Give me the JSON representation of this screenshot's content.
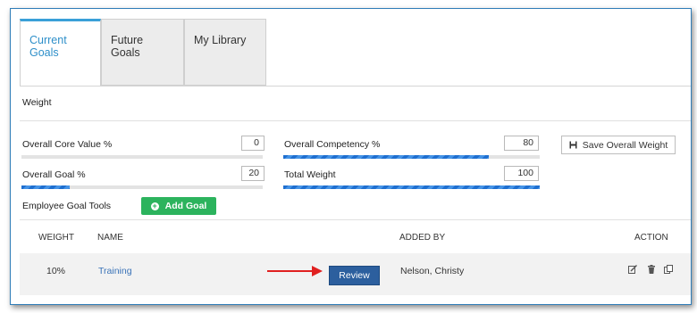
{
  "tabs": [
    {
      "label": "Current Goals",
      "active": true
    },
    {
      "label": "Future Goals",
      "active": false
    },
    {
      "label": "My Library",
      "active": false
    }
  ],
  "section": {
    "title": "Weight"
  },
  "weights": {
    "core_value": {
      "label": "Overall Core Value %",
      "value": "0",
      "progress": 0
    },
    "competency": {
      "label": "Overall Competency %",
      "value": "80",
      "progress": 0.8
    },
    "goal": {
      "label": "Overall Goal %",
      "value": "20",
      "progress": 0.2
    },
    "total": {
      "label": "Total Weight",
      "value": "100",
      "progress": 1.0
    }
  },
  "save_button": {
    "label": "Save Overall Weight",
    "icon": "save-icon"
  },
  "tools": {
    "label": "Employee Goal Tools",
    "add_button": "Add Goal",
    "add_icon": "plus-circle-icon"
  },
  "table": {
    "headers": {
      "weight": "WEIGHT",
      "name": "NAME",
      "added_by": "ADDED BY",
      "action": "ACTION"
    },
    "rows": [
      {
        "weight": "10%",
        "name": "Training",
        "review": "Review",
        "added_by": "Nelson, Christy",
        "actions": [
          "edit-icon",
          "trash-icon",
          "copy-icon"
        ]
      }
    ]
  },
  "colors": {
    "accent": "#3aa0d8",
    "add_green": "#2cb35d",
    "review_blue": "#2c5f9e",
    "annotation_arrow": "#e02020"
  }
}
